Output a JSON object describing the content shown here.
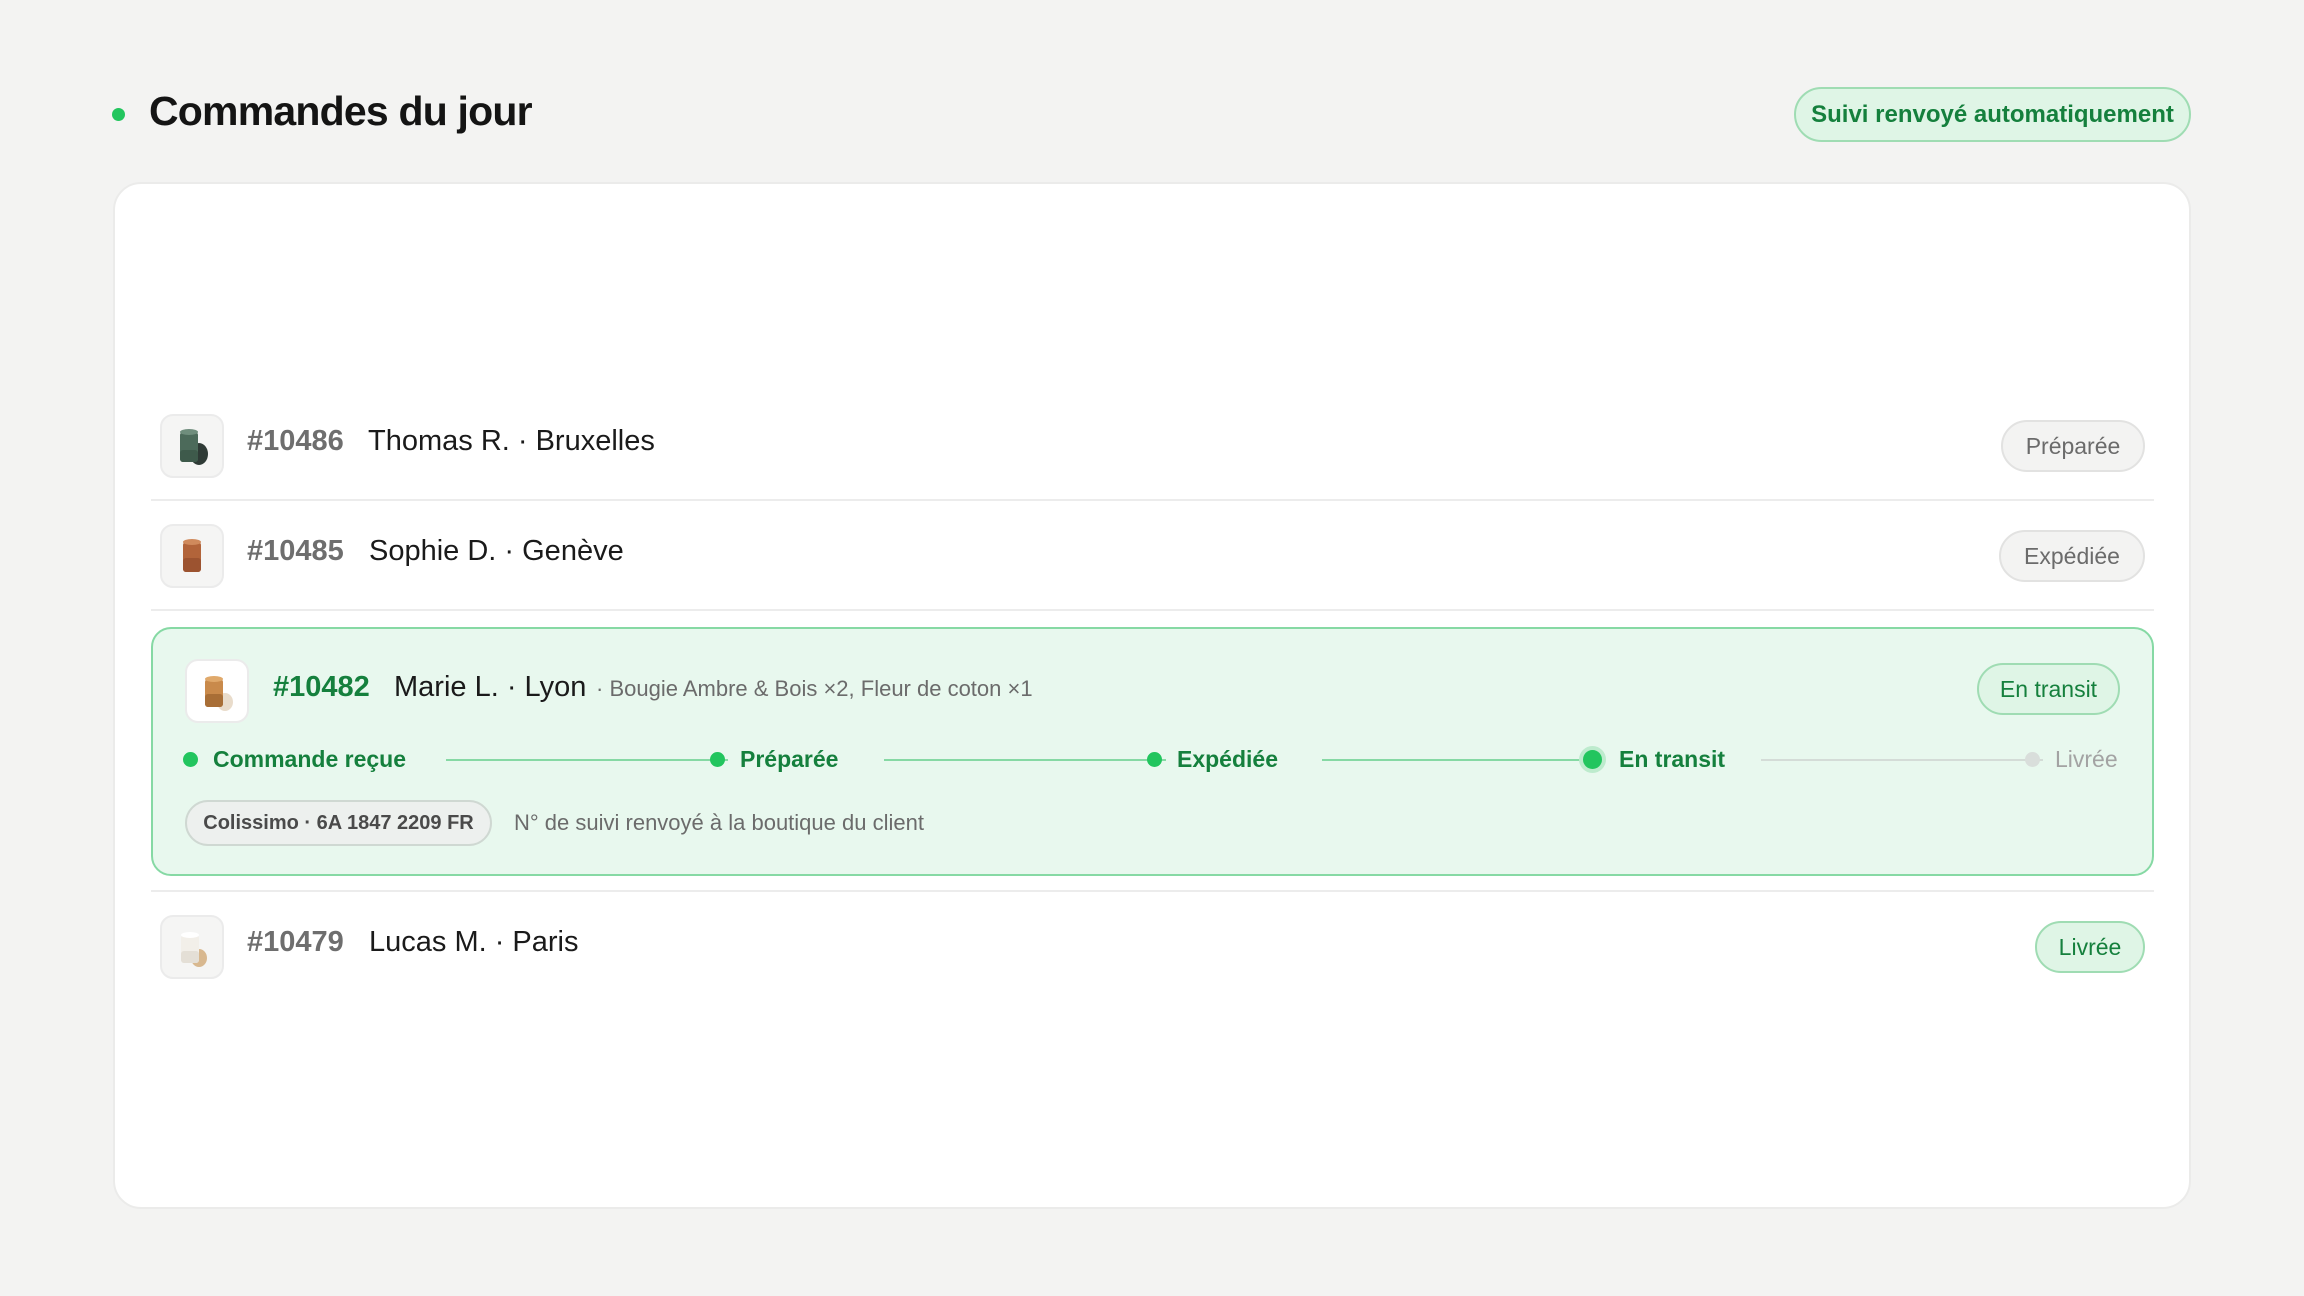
{
  "header": {
    "title": "Commandes du jour",
    "auto_badge": "Suivi renvoyé automatiquement"
  },
  "orders": [
    {
      "id": "#10486",
      "customer": "Thomas R. · Bruxelles",
      "status": "Préparée",
      "thumb_icon": "green-candle-icon"
    },
    {
      "id": "#10485",
      "customer": "Sophie D. · Genève",
      "status": "Expédiée",
      "thumb_icon": "terracotta-candle-icon"
    },
    {
      "id": "#10482",
      "customer": "Marie L. · Lyon",
      "items": "· Bougie Ambre & Bois ×2, Fleur de coton ×1",
      "status": "En transit",
      "thumb_icon": "amber-candle-icon"
    },
    {
      "id": "#10479",
      "customer": "Lucas M. · Paris",
      "status": "Livrée",
      "thumb_icon": "white-candle-icon"
    }
  ],
  "timeline": {
    "steps": [
      {
        "label": "Commande reçue",
        "state": "done"
      },
      {
        "label": "Préparée",
        "state": "done"
      },
      {
        "label": "Expédiée",
        "state": "done"
      },
      {
        "label": "En transit",
        "state": "current"
      },
      {
        "label": "Livrée",
        "state": "pending"
      }
    ]
  },
  "tracking": {
    "chip": "Colissimo · 6A 1847 2209 FR",
    "note": "N° de suivi renvoyé à la boutique du client"
  },
  "colors": {
    "accent": "#22c55e",
    "accent_dark": "#15803d",
    "active_bg": "#e8f8ee"
  }
}
